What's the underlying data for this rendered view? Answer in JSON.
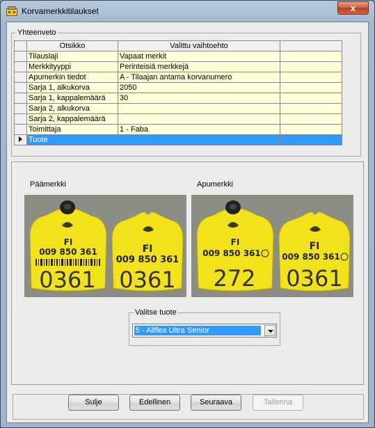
{
  "window": {
    "title": "Korvamerkkitilaukset",
    "close_glyph": "x"
  },
  "summary": {
    "legend": "Yhteenveto",
    "columns": [
      "Otsikko",
      "Valittu vaihtoehto",
      ""
    ],
    "rows": [
      {
        "title": "Tilauslaji",
        "value": "Vapaat merkit",
        "extra": ""
      },
      {
        "title": "Merkkityyppi",
        "value": "Perinteisiä merkkejä",
        "extra": ""
      },
      {
        "title": "Apumerkin tiedot",
        "value": "A - Tilaajan antama korvanumero",
        "extra": ""
      },
      {
        "title": "Sarja 1, alkukorva",
        "value": "2050",
        "extra": ""
      },
      {
        "title": "Sarja 1, kappalemäärä",
        "value": "30",
        "extra": ""
      },
      {
        "title": "Sarja 2, alkukorva",
        "value": "",
        "extra": ""
      },
      {
        "title": "Sarja 2, kappalemäärä",
        "value": "",
        "extra": ""
      },
      {
        "title": "Toimittaja",
        "value": "1 - Faba",
        "extra": ""
      },
      {
        "title": "Tuote",
        "value": "",
        "extra": "",
        "selected": true
      }
    ]
  },
  "product": {
    "main_tag_label": "Päämerkki",
    "aux_tag_label": "Apumerkki",
    "main_tag": {
      "left": {
        "country": "FI",
        "code": "009 850 361",
        "big": "0361"
      },
      "right": {
        "country": "FI",
        "code": "009 850 361",
        "big": "0361"
      }
    },
    "aux_tag": {
      "left": {
        "country": "FI",
        "code": "009 850 361",
        "big": "272"
      },
      "right": {
        "country": "FI",
        "code": "009 850 361",
        "big": "0361"
      }
    },
    "select_legend": "Valitse tuote",
    "selected_product": "5 - Allflex Ultra Senior"
  },
  "buttons": {
    "close": "Sulje",
    "previous": "Edellinen",
    "next": "Seuraava",
    "save": "Tallenna"
  },
  "colors": {
    "row_bg": "#ffffd8",
    "selection": "#3399ff",
    "tag_yellow": "#f2e21a"
  }
}
